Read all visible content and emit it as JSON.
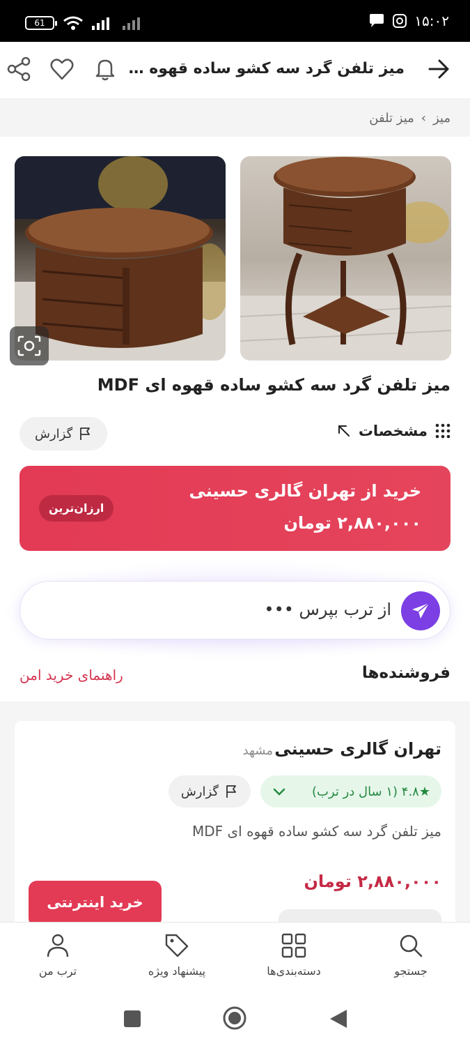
{
  "status_bar": {
    "battery": "61",
    "time": "۱۵:۰۲"
  },
  "app_bar": {
    "title": "میز تلفن گرد سه کشو ساده قهوه ای MDF"
  },
  "breadcrumb": {
    "items": [
      "میز",
      "میز تلفن"
    ],
    "separator": "›"
  },
  "product": {
    "title": "میز تلفن گرد سه کشو ساده قهوه ای MDF",
    "specs_label": "مشخصات",
    "report_label": "گزارش"
  },
  "best_offer": {
    "shop_line": "خرید از تهران گالری حسینی",
    "price": "۲,۸۸۰,۰۰۰ تومان",
    "badge": "ارزان‌ترین"
  },
  "ask": {
    "placeholder": "از ترب بپرس •••"
  },
  "sellers": {
    "heading": "فروشنده‌ها",
    "guide_link": "راهنمای خرید امن",
    "items": [
      {
        "name": "تهران گالری حسینی",
        "city": "مشهد",
        "rating": "★۴.۸ (۱ سال در ترب)",
        "report_label": "گزارش",
        "description": "میز تلفن گرد سه کشو ساده قهوه ای MDF",
        "price": "۲,۸۸۰,۰۰۰ تومان",
        "buy_label": "خرید اینترنتی"
      }
    ]
  },
  "bottom_nav": {
    "items": [
      {
        "label": "جستجو",
        "icon": "search-icon"
      },
      {
        "label": "دسته‌بندی‌ها",
        "icon": "grid-icon"
      },
      {
        "label": "پیشنهاد ویژه",
        "icon": "tag-icon"
      },
      {
        "label": "ترب من",
        "icon": "user-icon"
      }
    ]
  },
  "colors": {
    "accent_red": "#e33a55",
    "ask_purple": "#7b3fe4",
    "rating_green": "#23883f"
  }
}
